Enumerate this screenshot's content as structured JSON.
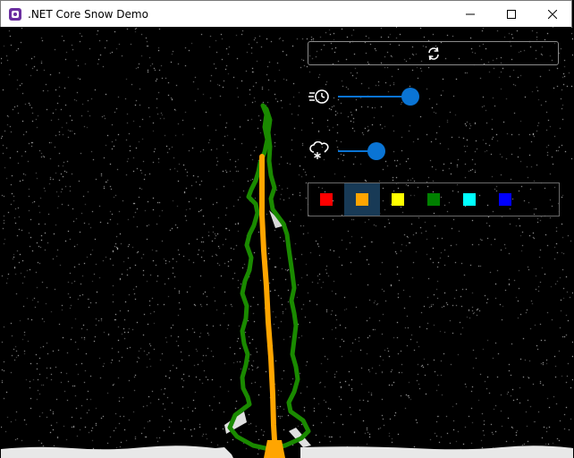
{
  "window": {
    "title": ".NET Core Snow Demo"
  },
  "icons": {
    "app": "app-icon",
    "minimize": "minimize-icon",
    "maximize": "maximize-icon",
    "close": "close-icon",
    "refresh": "refresh-icon",
    "speed": "speed-icon",
    "snow_amount": "snow-cloud-icon"
  },
  "controls": {
    "speed_slider": {
      "value_fraction": 0.85
    },
    "snow_slider": {
      "value_fraction": 0.45
    }
  },
  "palette": {
    "selected_index": 1,
    "colors": [
      "#ff0000",
      "#ffa500",
      "#ffff00",
      "#008000",
      "#00ffff",
      "#0000ff"
    ]
  },
  "drawing": {
    "background": "#000000",
    "tree_color": "#1a8a00",
    "trunk_color": "#ffa500",
    "snow_color": "#ffffff"
  }
}
